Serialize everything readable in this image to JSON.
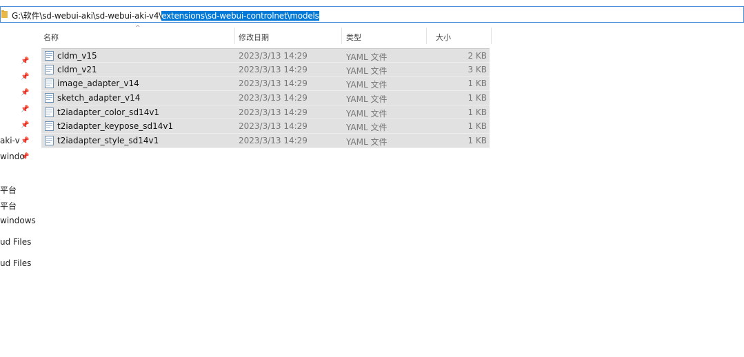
{
  "address": {
    "prefix": "G:\\软件\\sd-webui-aki\\sd-webui-aki-v4\\",
    "selected": "extensions\\sd-webui-controlnet\\models"
  },
  "columns": {
    "name": "名称",
    "date": "修改日期",
    "type": "类型",
    "size": "大小"
  },
  "files": [
    {
      "name": "cldm_v15",
      "date": "2023/3/13 14:29",
      "type": "YAML 文件",
      "size": "2 KB"
    },
    {
      "name": "cldm_v21",
      "date": "2023/3/13 14:29",
      "type": "YAML 文件",
      "size": "3 KB"
    },
    {
      "name": "image_adapter_v14",
      "date": "2023/3/13 14:29",
      "type": "YAML 文件",
      "size": "1 KB"
    },
    {
      "name": "sketch_adapter_v14",
      "date": "2023/3/13 14:29",
      "type": "YAML 文件",
      "size": "1 KB"
    },
    {
      "name": "t2iadapter_color_sd14v1",
      "date": "2023/3/13 14:29",
      "type": "YAML 文件",
      "size": "1 KB"
    },
    {
      "name": "t2iadapter_keypose_sd14v1",
      "date": "2023/3/13 14:29",
      "type": "YAML 文件",
      "size": "1 KB"
    },
    {
      "name": "t2iadapter_style_sd14v1",
      "date": "2023/3/13 14:29",
      "type": "YAML 文件",
      "size": "1 KB"
    }
  ],
  "nav": {
    "items": [
      "aki-v",
      "windo",
      "平台",
      "平台",
      "windows",
      "ud Files",
      "ud Files"
    ]
  },
  "icons": {
    "pin": "pin-icon",
    "file": "yaml-file-icon",
    "folder": "folder-icon",
    "sort": "sort-up-icon"
  }
}
